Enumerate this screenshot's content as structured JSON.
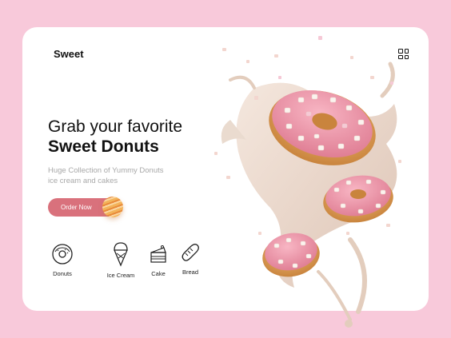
{
  "brand": "Sweet",
  "hero": {
    "title_line1": "Grab your favorite",
    "title_line2": "Sweet Donuts",
    "subtitle_line1": "Huge Collection of Yummy Donuts",
    "subtitle_line2": "ice cream and cakes",
    "cta_label": "Order Now"
  },
  "categories": [
    {
      "label": "Donuts",
      "icon": "donut-icon"
    },
    {
      "label": "Ice Cream",
      "icon": "ice-cream-icon"
    },
    {
      "label": "Cake",
      "icon": "cake-icon"
    },
    {
      "label": "Bread",
      "icon": "bread-icon"
    }
  ],
  "colors": {
    "background": "#f8c9da",
    "accent": "#d9717c",
    "text": "#111111",
    "muted": "#a8a8a8"
  },
  "header_icon": "grid-menu-icon"
}
